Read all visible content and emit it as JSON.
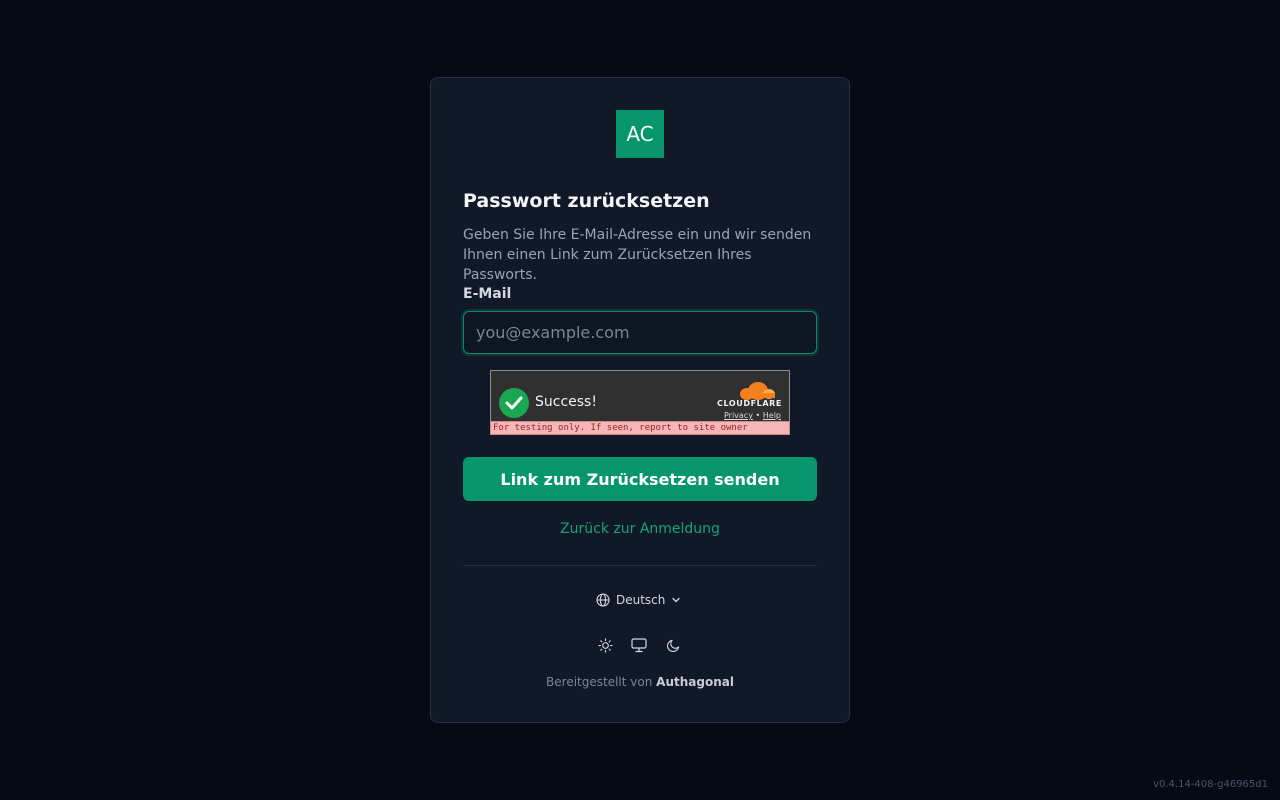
{
  "logo": {
    "text": "AC",
    "color": "#07956b"
  },
  "form": {
    "title": "Passwort zurücksetzen",
    "description": "Geben Sie Ihre E-Mail-Adresse ein und wir senden Ihnen einen Link zum Zurücksetzen Ihres Passworts.",
    "email_label": "E-Mail",
    "email_value": "",
    "email_placeholder": "you@example.com",
    "submit_label": "Link zum Zurücksetzen senden",
    "back_link": "Zurück zur Anmeldung"
  },
  "captcha": {
    "status": "Success!",
    "brand": "CLOUDFLARE",
    "privacy": "Privacy",
    "separator": "•",
    "help": "Help",
    "testing_note": "For testing only. If seen, report to site owner"
  },
  "footer": {
    "language": "Deutsch",
    "theme_icons": [
      "sun-icon",
      "monitor-icon",
      "moon-icon"
    ],
    "powered_prefix": "Bereitgestellt von",
    "powered_brand": "Authagonal"
  },
  "version": "v0.4.14-408-g46965d1",
  "colors": {
    "accent": "#07956b",
    "link": "#14a776",
    "background": "#060a15",
    "card": "#111827"
  }
}
